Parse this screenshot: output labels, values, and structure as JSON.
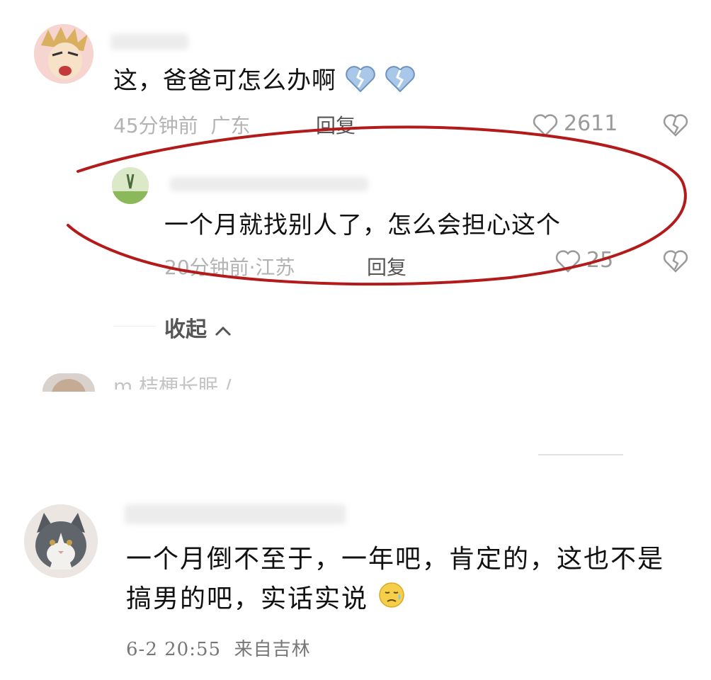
{
  "comments": [
    {
      "text": "这，爸爸可怎么办啊",
      "emoji": [
        "broken-heart-icon",
        "broken-heart-icon"
      ],
      "time": "45分钟前",
      "location": "广东",
      "reply_label": "回复",
      "likes": "2611"
    },
    {
      "text": "一个月就找别人了，怎么会担心这个",
      "time": "20分钟前",
      "location": "江苏",
      "separator": "·",
      "reply_label": "回复",
      "likes": "25"
    }
  ],
  "collapse_label": "收起",
  "next_comment_name_partial": "m 桔梗长眠 /",
  "second_screenshot": {
    "text": "一个月倒不至于，一年吧，肯定的，这也不是搞男的吧，实话实说",
    "emoji": "sweat-face-icon",
    "date": "6-2 20:55",
    "source": "来自吉林"
  },
  "colors": {
    "highlight_ellipse": "#b31b1b",
    "text": "#111111",
    "meta": "#b3b3b3",
    "heart_outline": "#9a9a9a"
  }
}
